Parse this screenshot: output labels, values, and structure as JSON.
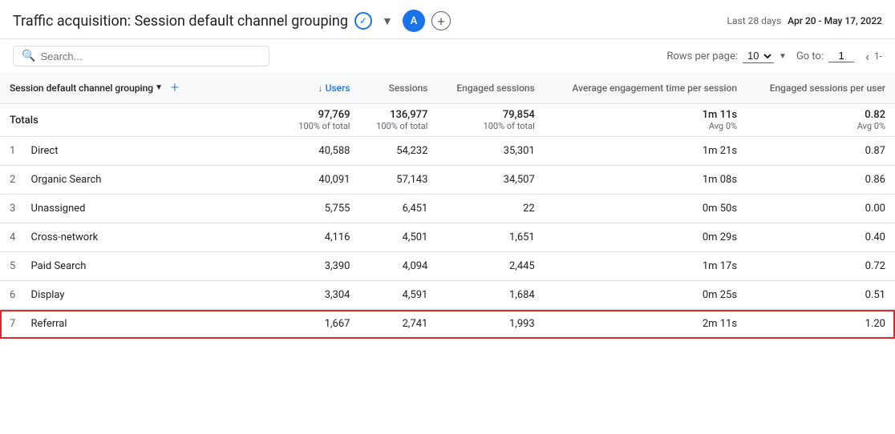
{
  "header": {
    "title": "Traffic acquisition: Session default channel grouping",
    "avatar": "A",
    "date_range_label": "Last 28 days",
    "date_range": "Apr 20 - May 17, 2022"
  },
  "toolbar": {
    "search_placeholder": "Search...",
    "rows_label": "Rows per page:",
    "rows_value": "10",
    "goto_label": "Go to:",
    "goto_value": "1",
    "page_indicator": "1-"
  },
  "table": {
    "col_channel_label": "Session default channel grouping",
    "col_users_label": "↓ Users",
    "col_sessions_label": "Sessions",
    "col_engaged_label": "Engaged sessions",
    "col_avg_engagement_label": "Average engagement time per session",
    "col_engaged_per_user_label": "Engaged sessions per user",
    "totals": {
      "label": "Totals",
      "users": "97,769",
      "users_sub": "100% of total",
      "sessions": "136,977",
      "sessions_sub": "100% of total",
      "engaged": "79,854",
      "engaged_sub": "100% of total",
      "avg_engagement": "1m 11s",
      "avg_engagement_sub": "Avg 0%",
      "engaged_per_user": "0.82",
      "engaged_per_user_sub": "Avg 0%"
    },
    "rows": [
      {
        "num": "1",
        "channel": "Direct",
        "users": "40,588",
        "sessions": "54,232",
        "engaged": "35,301",
        "avg_engagement": "1m 21s",
        "engaged_per_user": "0.87",
        "highlighted": false
      },
      {
        "num": "2",
        "channel": "Organic Search",
        "users": "40,091",
        "sessions": "57,143",
        "engaged": "34,507",
        "avg_engagement": "1m 08s",
        "engaged_per_user": "0.86",
        "highlighted": false
      },
      {
        "num": "3",
        "channel": "Unassigned",
        "users": "5,755",
        "sessions": "6,451",
        "engaged": "22",
        "avg_engagement": "0m 50s",
        "engaged_per_user": "0.00",
        "highlighted": false
      },
      {
        "num": "4",
        "channel": "Cross-network",
        "users": "4,116",
        "sessions": "4,501",
        "engaged": "1,651",
        "avg_engagement": "0m 29s",
        "engaged_per_user": "0.40",
        "highlighted": false
      },
      {
        "num": "5",
        "channel": "Paid Search",
        "users": "3,390",
        "sessions": "4,094",
        "engaged": "2,445",
        "avg_engagement": "1m 17s",
        "engaged_per_user": "0.72",
        "highlighted": false
      },
      {
        "num": "6",
        "channel": "Display",
        "users": "3,304",
        "sessions": "4,591",
        "engaged": "1,684",
        "avg_engagement": "0m 25s",
        "engaged_per_user": "0.51",
        "highlighted": false
      },
      {
        "num": "7",
        "channel": "Referral",
        "users": "1,667",
        "sessions": "2,741",
        "engaged": "1,993",
        "avg_engagement": "2m 11s",
        "engaged_per_user": "1.20",
        "highlighted": true
      }
    ]
  }
}
